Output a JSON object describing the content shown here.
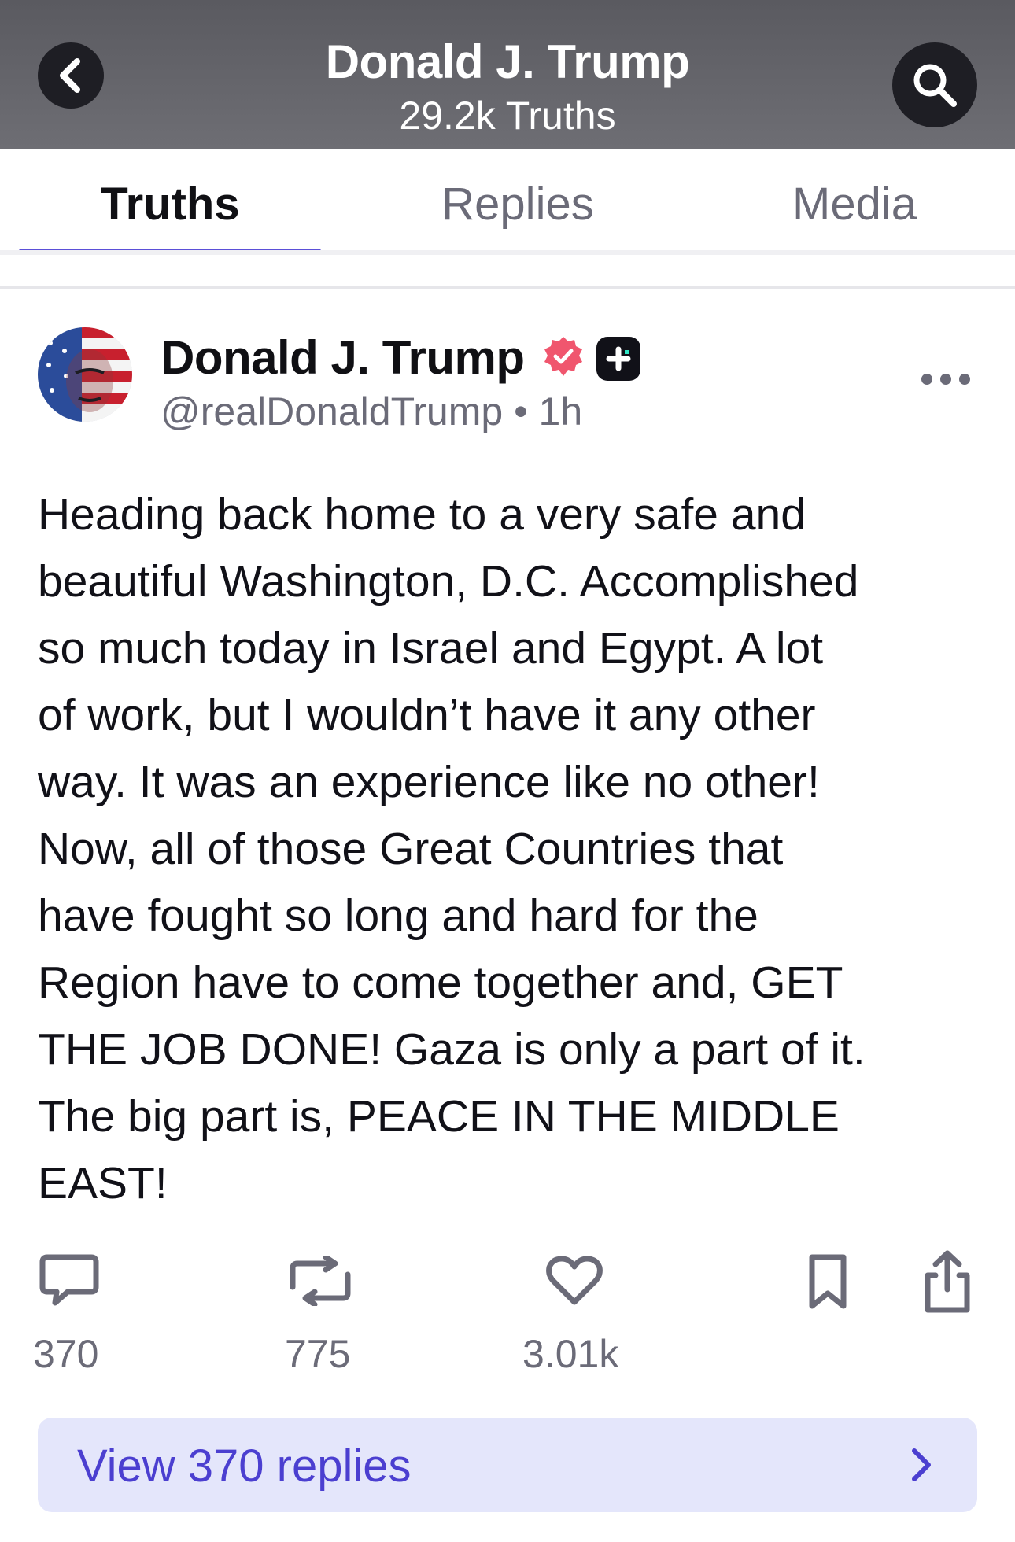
{
  "header": {
    "title": "Donald J. Trump",
    "subtitle": "29.2k Truths",
    "back_icon": "chevron-left-icon",
    "search_icon": "search-icon"
  },
  "tabs": [
    {
      "label": "Truths",
      "active": true
    },
    {
      "label": "Replies",
      "active": false
    },
    {
      "label": "Media",
      "active": false
    }
  ],
  "post": {
    "author": "Donald J. Trump",
    "handle": "@realDonaldTrump",
    "separator": "•",
    "time": "1h",
    "badges": [
      "verified-badge-icon",
      "truth-plus-badge-icon"
    ],
    "menu_icon": "more-horizontal-icon",
    "body_lines": [
      "Heading back home to a very safe and",
      "beautiful Washington, D.C. Accomplished",
      "so much today in Israel and Egypt. A lot",
      "of work, but I wouldn’t have it any other",
      "way. It was an experience like no other!",
      "Now, all of those Great Countries that",
      "have fought so long and hard for the",
      "Region have to come together and, GET",
      "THE JOB DONE! Gaza is only a part of it.",
      "The big part is, PEACE IN THE MIDDLE",
      "EAST!"
    ],
    "actions": {
      "replies": "370",
      "retruths": "775",
      "likes": "3.01k"
    }
  },
  "view_replies": {
    "label": "View 370 replies"
  },
  "colors": {
    "accent": "#5b4fd8",
    "verified": "#f0566e",
    "view_replies_bg": "#e4e6fb",
    "view_replies_text": "#4b3fd0"
  }
}
